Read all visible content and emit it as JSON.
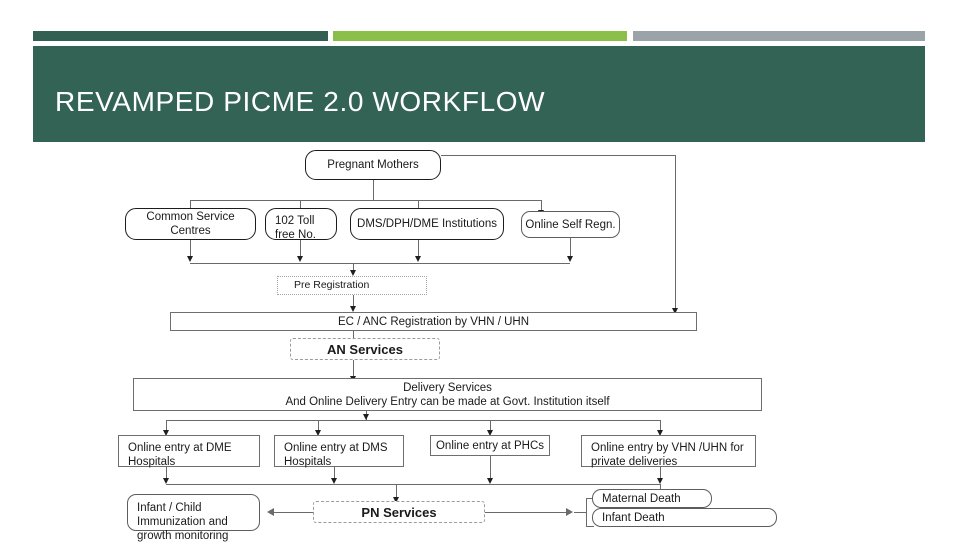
{
  "slide": {
    "title": "REVAMPED PICME 2.0 WORKFLOW",
    "accent_colors": {
      "dark_green": "#325f51",
      "green": "#8ac04a",
      "gray": "#9aa4a8",
      "banner": "#336355",
      "title_text": "#ffffff"
    }
  },
  "diagram": {
    "nodes": {
      "pregnant_mothers": "Pregnant Mothers",
      "common_service_centres": "Common Service Centres",
      "toll_free": "102 Toll free No.",
      "dms_dph_dme": "DMS/DPH/DME Institutions",
      "online_self_regn": "Online  Self Regn.",
      "pre_registration": "Pre Registration",
      "ec_anc_registration": "EC / ANC Registration by VHN / UHN",
      "an_services": "AN Services",
      "delivery_services_line1": "Delivery Services",
      "delivery_services_line2": "And Online Delivery Entry can be made at Govt. Institution itself",
      "online_entry_dme": "Online entry at DME Hospitals",
      "online_entry_dms": "Online entry at DMS Hospitals",
      "online_entry_phc": "Online entry at PHCs",
      "online_entry_vhn_uhn": "Online entry by VHN /UHN for private deliveries",
      "infant_child_immunization": "Infant / Child Immunization and growth monitoring",
      "pn_services": "PN Services",
      "maternal_death": "Maternal Death",
      "infant_death": "Infant Death"
    }
  }
}
